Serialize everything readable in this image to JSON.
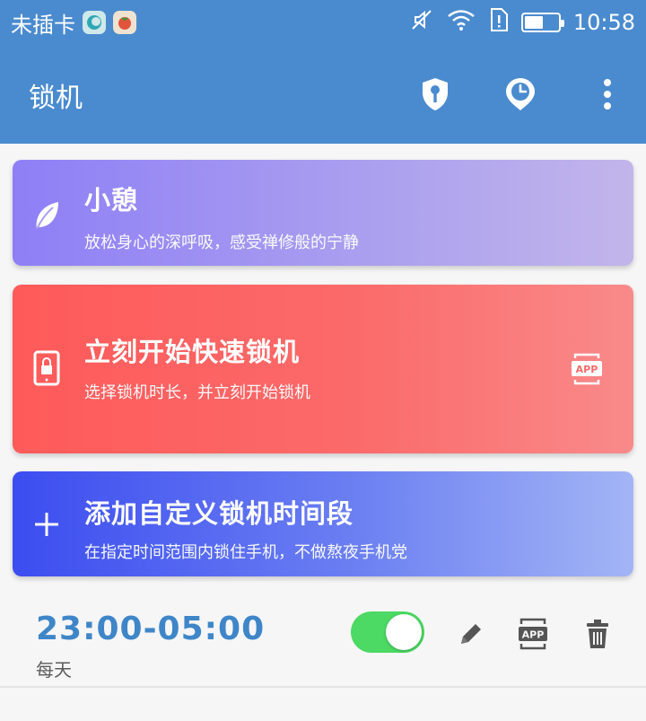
{
  "status_bar": {
    "carrier": "未插卡",
    "time": "10:58",
    "battery_level": 0.55,
    "icons": [
      "mini-app-icon",
      "tomato-app-icon",
      "mute-icon",
      "wifi-icon",
      "sim-alert-icon",
      "battery-icon"
    ]
  },
  "app_bar": {
    "title": "锁机",
    "actions": [
      "shield-key-icon",
      "clock-pin-icon",
      "more-vert-icon"
    ]
  },
  "cards": {
    "rest": {
      "title": "小憩",
      "subtitle": "放松身心的深呼吸，感受禅修般的宁静",
      "icon": "leaf-icon"
    },
    "quick_lock": {
      "title": "立刻开始快速锁机",
      "subtitle": "选择锁机时长，并立刻开始锁机",
      "icon": "tablet-lock-icon",
      "right_icon": "app-whitelist-icon",
      "right_icon_text": "APP"
    },
    "custom": {
      "title": "添加自定义锁机时间段",
      "subtitle": "在指定时间范围内锁住手机，不做熬夜手机党",
      "icon": "plus-icon"
    }
  },
  "schedule": {
    "time_range": "23:00-05:00",
    "repeat": "每天",
    "enabled": true,
    "app_label": "APP",
    "actions": [
      "toggle-switch",
      "edit-icon",
      "app-whitelist-icon",
      "trash-icon"
    ]
  },
  "colors": {
    "primary": "#4a8bcf",
    "time_text": "#3f86c8",
    "toggle_on": "#4cd964",
    "quick_card": "#ff5a5a",
    "rest_card": "#8e7ff6",
    "custom_card": "#3c4df0"
  }
}
